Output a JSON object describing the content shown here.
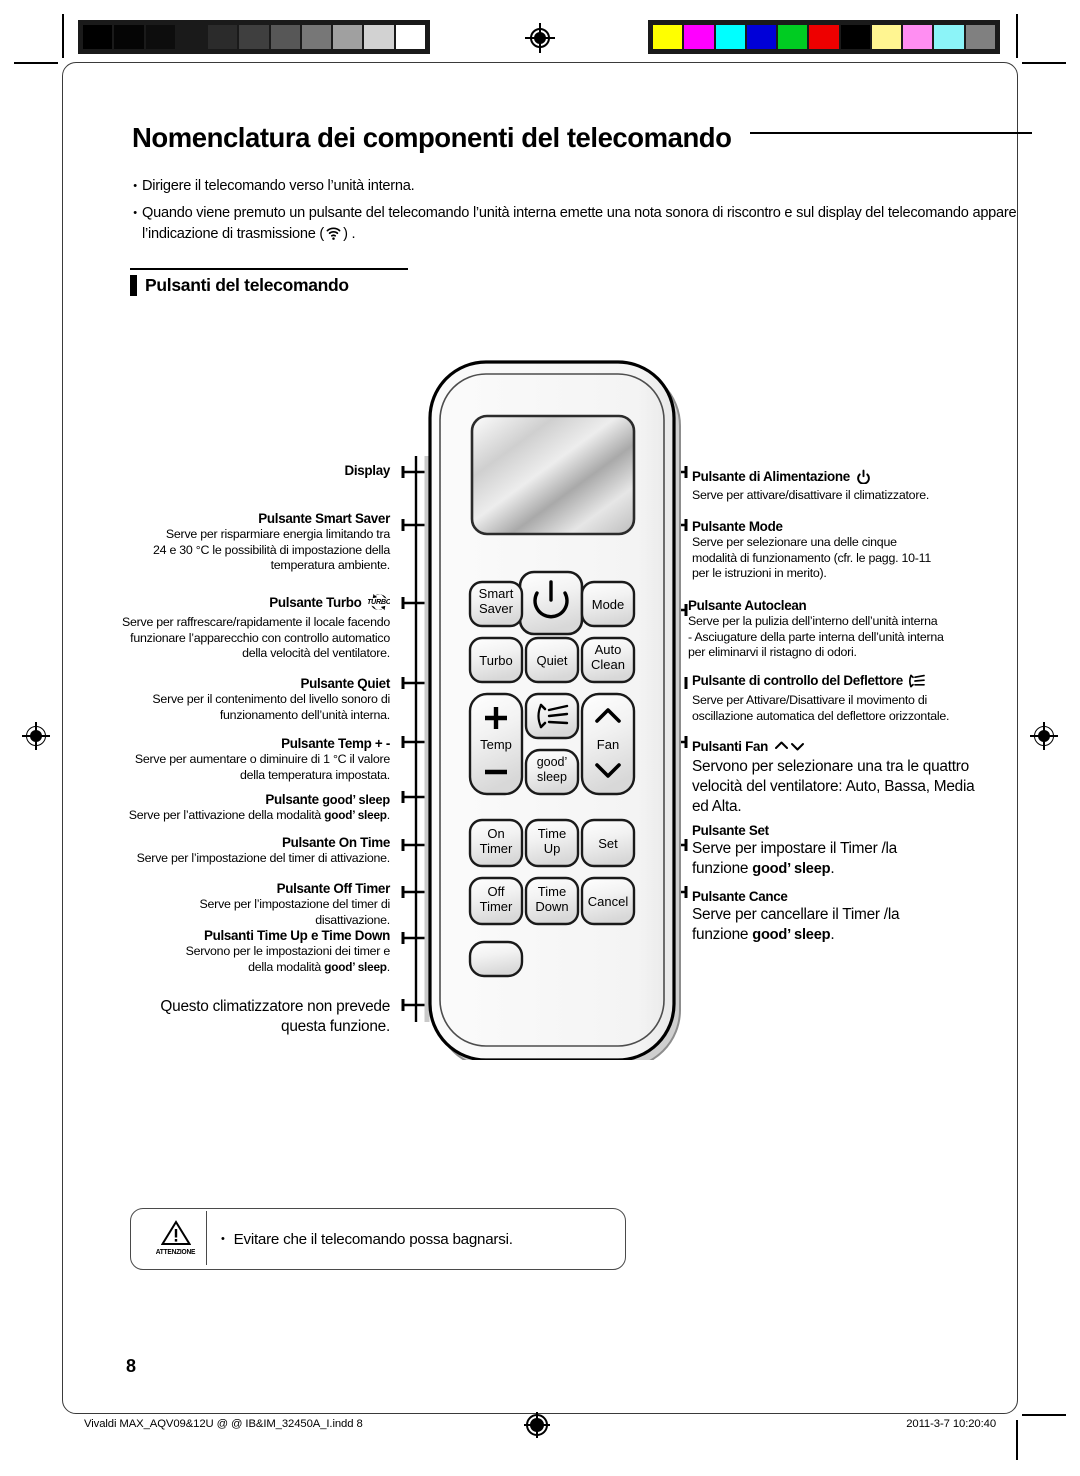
{
  "document": {
    "title": "Nomenclatura dei componenti del telecomando",
    "page_number": "8",
    "section_heading": "Pulsanti del telecomando"
  },
  "intro": {
    "bullet_glyph": "•",
    "items": [
      {
        "text_before": "Dirigere il telecomando verso l’unità interna.",
        "icon": "",
        "text_after": ""
      },
      {
        "text_before": "Quando  viene premuto un pulsante del telecomando l’unità interna emette una nota sonora di riscontro e sul display del telecomando appare l’indicazione di trasmissione (",
        "icon": "wifi-transmission-icon",
        "text_after": ") ."
      }
    ]
  },
  "calibration": {
    "grayscale": [
      "#000000",
      "#050505",
      "#0d0d0d",
      "#1a1a1a",
      "#2b2b2b",
      "#3f3f3f",
      "#575757",
      "#777777",
      "#a0a0a0",
      "#d2d2d2",
      "#ffffff"
    ],
    "color": [
      "#ffff00",
      "#ff00ff",
      "#00ffff",
      "#0000d8",
      "#00cc22",
      "#ee0000",
      "#000000",
      "#fff591",
      "#ff8ef2",
      "#8cf4f8",
      "#808080"
    ]
  },
  "remote": {
    "name": "remote-control-illustration",
    "display_label": "",
    "buttons": [
      {
        "id": "power",
        "label": "",
        "icon": "power-icon"
      },
      {
        "id": "smart-saver",
        "label": "Smart\nSaver",
        "line1": "Smart",
        "line2": "Saver"
      },
      {
        "id": "mode",
        "label": "Mode"
      },
      {
        "id": "turbo",
        "label": "Turbo"
      },
      {
        "id": "quiet",
        "label": "Quiet"
      },
      {
        "id": "auto-clean",
        "label": "Auto\nClean",
        "line1": "Auto",
        "line2": "Clean"
      },
      {
        "id": "temp",
        "label": "Temp",
        "plus": "+",
        "minus": "−"
      },
      {
        "id": "deflector",
        "label": "",
        "icon": "deflector-swing-icon"
      },
      {
        "id": "fan",
        "label": "Fan",
        "icon_up": "chevron-up-icon",
        "icon_down": "chevron-down-icon"
      },
      {
        "id": "good-sleep",
        "label": "good’\nsleep",
        "line1": "good’",
        "line2": "sleep"
      },
      {
        "id": "on-timer",
        "label": "On\nTimer",
        "line1": "On",
        "line2": "Timer"
      },
      {
        "id": "time-up",
        "label": "Time\nUp",
        "line1": "Time",
        "line2": "Up"
      },
      {
        "id": "set",
        "label": "Set"
      },
      {
        "id": "off-timer",
        "label": "Off\nTimer",
        "line1": "Off",
        "line2": "Timer"
      },
      {
        "id": "time-down",
        "label": "Time\nDown",
        "line1": "Time",
        "line2": "Down"
      },
      {
        "id": "cancel",
        "label": "Cancel"
      },
      {
        "id": "unused",
        "label": ""
      }
    ]
  },
  "callouts_left": [
    {
      "name": "display",
      "label": "Display",
      "desc": []
    },
    {
      "name": "smart-saver",
      "label": "Pulsante Smart Saver",
      "desc": [
        "Serve per risparmiare energia limitando tra",
        "24 e 30 °C le possibilità di impostazione della",
        "temperatura ambiente."
      ]
    },
    {
      "name": "turbo",
      "label": "Pulsante Turbo",
      "label_icon": "turbo-icon",
      "desc": [
        "Serve per raffrescare/rapidamente il locale facendo",
        "funzionare  l’apparecchio con controllo automatico",
        "della velocità del ventilatore."
      ]
    },
    {
      "name": "quiet",
      "label": "Pulsante Quiet",
      "desc": [
        "Serve per il contenimento del livello sonoro di",
        "funzionamento dell’unità interna."
      ]
    },
    {
      "name": "temp",
      "label": "Pulsante Temp + -",
      "desc": [
        "Serve per aumentare o diminuire di 1 °C il valore",
        "della temperatura impostata."
      ]
    },
    {
      "name": "good-sleep",
      "label_pre": "Pulsante ",
      "label_gs": "good’ sleep",
      "desc_pre": "Serve per l’attivazione della modalità ",
      "desc_gs": "good’ sleep",
      "desc_post": "."
    },
    {
      "name": "on-time",
      "label": "Pulsante On Time",
      "desc": [
        "Serve per l’impostazione del timer di attivazione."
      ]
    },
    {
      "name": "off-timer",
      "label": "Pulsante Off Timer",
      "desc": [
        "Serve per l’impostazione del timer di disattivazione."
      ]
    },
    {
      "name": "time-up-down",
      "label": "Pulsanti Time Up e Time Down",
      "desc_line1": "Servono per le impostazioni dei timer  e",
      "desc_pre2": "della modalità ",
      "desc_gs2": "good’ sleep",
      "desc_post2": "."
    },
    {
      "name": "unused-function",
      "desc": [
        "Questo climatizzatore non prevede",
        "questa funzione."
      ]
    }
  ],
  "callouts_right": [
    {
      "name": "power",
      "label": "Pulsante di Alimentazione",
      "label_icon": "power-icon",
      "desc": [
        "Serve per attivare/disattivare il climatizzatore."
      ]
    },
    {
      "name": "mode",
      "label": "Pulsante Mode",
      "desc": [
        "Serve per selezionare una delle cinque",
        "modalità di funzionamento (cfr. le pagg. 10-11",
        "per le istruzioni in merito)."
      ]
    },
    {
      "name": "autoclean",
      "label": "Pulsante Autoclean",
      "desc": [
        "Serve per la pulizia dell’interno dell’unità interna",
        "- Asciugature della parte interna dell’unità interna",
        "per eliminarvi il ristagno di odori."
      ]
    },
    {
      "name": "deflector",
      "label": "Pulsante di controllo del Deflettore",
      "label_icon": "deflector-icon",
      "desc": [
        "Serve per Attivare/Disattivare il movimento di",
        "oscillazione automatica del deflettore orizzontale."
      ]
    },
    {
      "name": "fan",
      "label": "Pulsanti Fan",
      "label_icon": "fan-chevrons-icon",
      "desc": [
        "Servono per selezionare una tra le quattro",
        "velocità del ventilatore: Auto, Bassa, Media",
        "ed Alta."
      ]
    },
    {
      "name": "set",
      "label": "Pulsante Set",
      "desc_line1": "Serve per impostare il Timer /la",
      "desc_pre2": "funzione ",
      "desc_gs2": "good’ sleep",
      "desc_post2": "."
    },
    {
      "name": "cancel",
      "label": "Pulsante Cance",
      "desc_line1": "Serve per cancellare il Timer /la",
      "desc_pre2": "funzione ",
      "desc_gs2": "good’ sleep",
      "desc_post2": "."
    }
  ],
  "caution": {
    "tag": "ATTENZIONE",
    "icon": "warning-triangle-icon",
    "bullet": "•",
    "text": "Evitare che il telecomando possa bagnarsi."
  },
  "footer": {
    "file": "Vivaldi MAX_AQV09&12U @ @ IB&IM_32450A_I.indd   8",
    "timestamp": "2011-3-7   10:20:40",
    "reg_icon": "registration-target-icon"
  }
}
